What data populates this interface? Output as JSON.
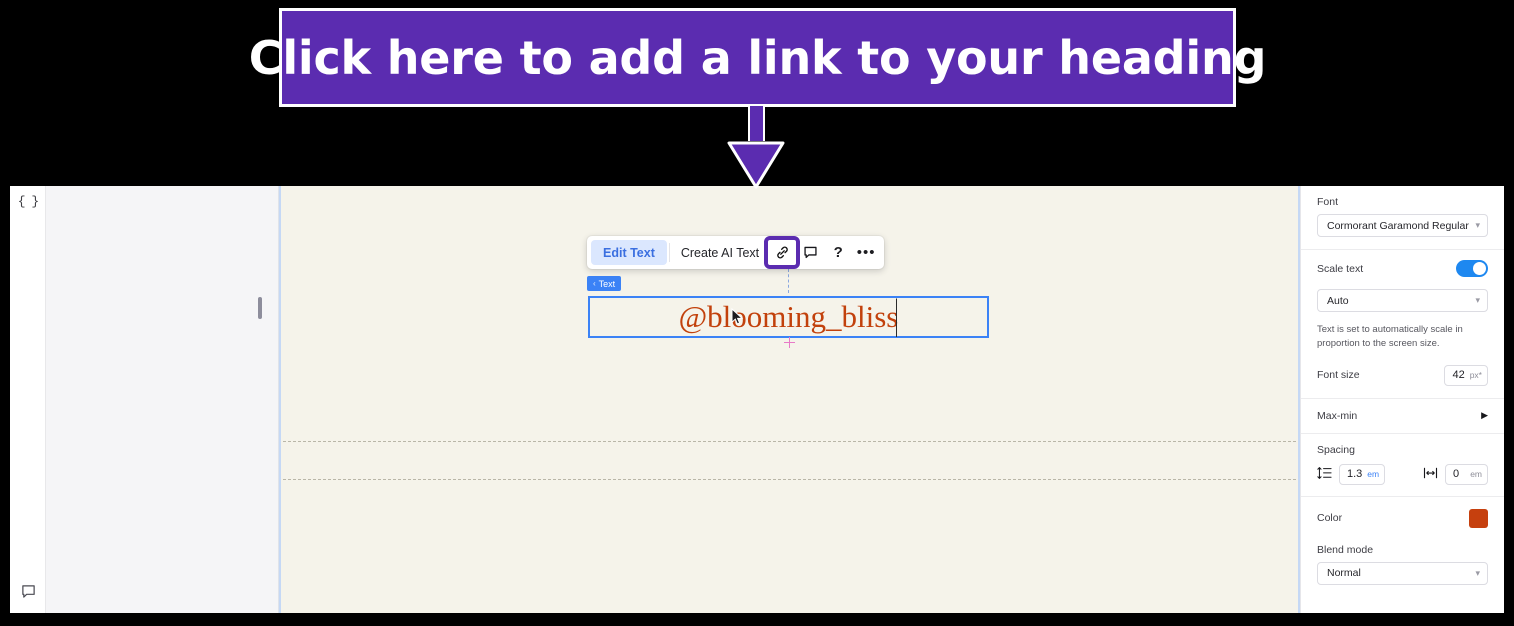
{
  "callout": {
    "text": "Click here to add a link to your heading",
    "bg_color": "#5b2cb0",
    "text_color": "#ffffff",
    "arrow": "down-arrow"
  },
  "left_rail": {
    "top_icon_name": "code-braces-icon",
    "top_icon_glyph": "{ }",
    "bottom_icon_name": "comment-icon"
  },
  "canvas": {
    "background_color": "#f5f3ea",
    "guide_count": 2
  },
  "toolbar": {
    "edit_text_label": "Edit Text",
    "create_ai_text_label": "Create AI Text",
    "link_icon_name": "link-icon",
    "comment_icon_name": "comment-icon",
    "help_icon_label": "?",
    "more_icon_label": "•••",
    "active_accent": "#3b6fe0",
    "active_bg": "#dbe7fe",
    "highlight_color": "#5b2cb0"
  },
  "text_element": {
    "badge_chevron": "‹",
    "badge_label": "Text",
    "content": "@blooming_bliss",
    "text_color": "#c2410c",
    "selection_color": "#3b82f6"
  },
  "right_panel": {
    "font": {
      "label": "Font",
      "value": "Cormorant Garamond Regular"
    },
    "scale_text": {
      "label": "Scale text",
      "enabled": true,
      "mode_value": "Auto",
      "help_text": "Text is set to automatically scale in proportion to the screen size."
    },
    "font_size": {
      "label": "Font size",
      "value": "42",
      "unit": "px*"
    },
    "max_min": {
      "label": "Max-min",
      "arrow": "▶"
    },
    "spacing": {
      "label": "Spacing",
      "line_height": {
        "icon_name": "line-height-icon",
        "value": "1.3",
        "unit": "em"
      },
      "letter_spacing": {
        "icon_name": "letter-spacing-icon",
        "value": "0",
        "unit": "em"
      }
    },
    "color": {
      "label": "Color",
      "value": "#c6400e"
    },
    "blend_mode": {
      "label": "Blend mode",
      "value": "Normal"
    }
  }
}
